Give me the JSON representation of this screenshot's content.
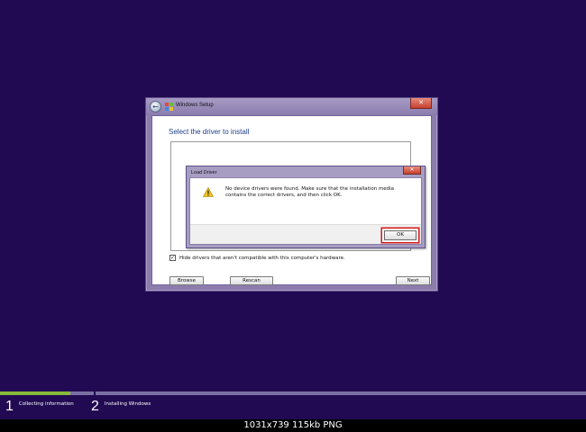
{
  "setup": {
    "title": "Windows Setup",
    "heading": "Select the driver to install",
    "hide_label": "Hide drivers that aren't compatible with this computer's hardware.",
    "browse": "Browse",
    "rescan": "Rescan",
    "next": "Next"
  },
  "dialog": {
    "title": "Load Driver",
    "message": "No device drivers were found. Make sure that the installation media contains the correct drivers, and then click OK.",
    "ok": "OK",
    "icon": "warning-icon"
  },
  "progress": {
    "fraction": 0.12,
    "steps": [
      {
        "num": "1",
        "label": "Collecting information"
      },
      {
        "num": "2",
        "label": "Installing Windows"
      }
    ]
  },
  "caption": "1031x739  115kb  PNG",
  "colors": {
    "background": "#220a52",
    "progress": "#88b83b",
    "highlight": "#d01818"
  }
}
